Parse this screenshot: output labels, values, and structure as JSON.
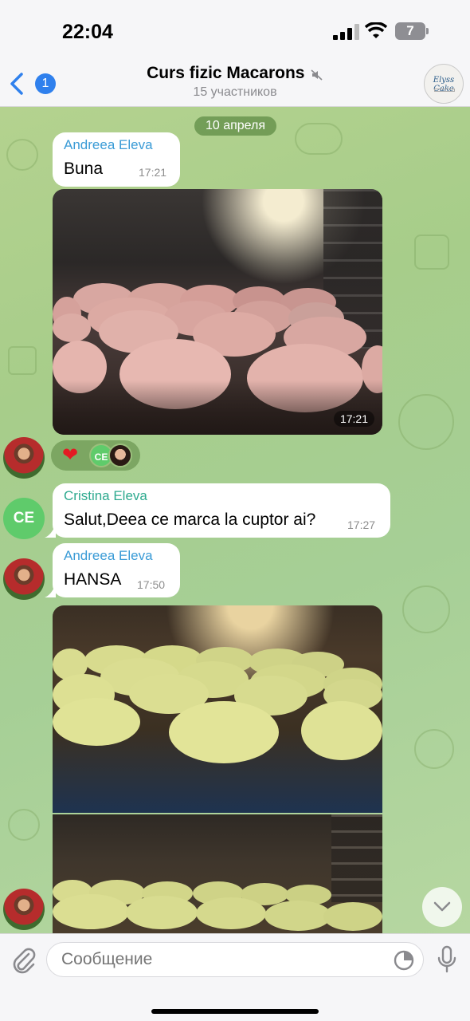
{
  "status_bar": {
    "time": "22:04",
    "battery": "7"
  },
  "header": {
    "back_badge": "1",
    "title": "Curs fizic Macarons",
    "subtitle": "15 участников",
    "group_avatar_text": "Elyss Cake"
  },
  "chat": {
    "date": "10 апреля",
    "messages": [
      {
        "sender": "Andreea Eleva",
        "text": "Buna",
        "time": "17:21"
      },
      {
        "photo_time": "17:21"
      },
      {
        "sender": "Cristina Eleva",
        "text": "Salut,Deea ce marca la cuptor ai?",
        "time": "17:27",
        "avatar_initials": "CE"
      },
      {
        "sender": "Andreea Eleva",
        "text": "HANSA",
        "time": "17:50"
      }
    ],
    "reactions": {
      "emoji": "❤",
      "initials": "CE"
    }
  },
  "input": {
    "placeholder": "Сообщение"
  },
  "icons": {
    "back": "chevron-left-icon",
    "mute": "muted-speaker-icon",
    "attach": "paperclip-icon",
    "sticker": "sticker-icon",
    "mic": "microphone-icon",
    "scroll": "chevron-down-icon"
  },
  "colors": {
    "accent": "#2f80ed",
    "sender_blue": "#3a9bd6",
    "sender_green": "#2eaa8f",
    "chat_bg": "#a7cd8a"
  }
}
